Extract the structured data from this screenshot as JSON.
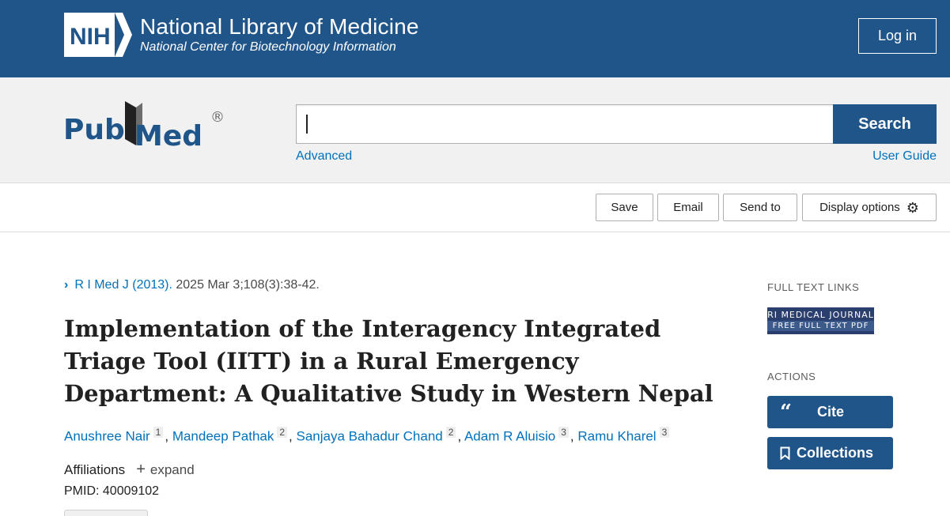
{
  "nih": {
    "title": "National Library of Medicine",
    "subtitle": "National Center for Biotechnology Information",
    "login": "Log in",
    "badge": "NIH"
  },
  "search": {
    "logo_left": "Pub",
    "logo_right": "Med",
    "registered": "®",
    "value": "",
    "button": "Search",
    "advanced": "Advanced",
    "user_guide": "User Guide"
  },
  "toolbar": {
    "save": "Save",
    "email": "Email",
    "send_to": "Send to",
    "display_options": "Display options",
    "gear_icon": "gear-icon"
  },
  "article": {
    "journal": "R I Med J (2013).",
    "citation": " 2025 Mar 3;108(3):38-42.",
    "title": "Implementation of the Interagency Integrated Triage Tool (IITT) in a Rural Emergency Department: A Qualitative Study in Western Nepal",
    "authors": [
      {
        "name": "Anushree Nair",
        "aff": "1"
      },
      {
        "name": "Mandeep Pathak",
        "aff": "2"
      },
      {
        "name": "Sanjaya Bahadur Chand",
        "aff": "2"
      },
      {
        "name": "Adam R Aluisio",
        "aff": "3"
      },
      {
        "name": "Ramu Kharel",
        "aff": "3"
      }
    ],
    "affiliations_label": "Affiliations",
    "expand_label": "expand",
    "pmid": "PMID: 40009102"
  },
  "sidebar": {
    "full_text_heading": "FULL TEXT LINKS",
    "ri_badge_top": "RI MEDICAL JOURNAL",
    "ri_badge_bottom": "FREE FULL TEXT PDF",
    "actions_heading": "ACTIONS",
    "cite": "Cite",
    "collections": "Collections"
  },
  "colors": {
    "nih_blue": "#20558a",
    "link_blue": "#0071bc",
    "band_gray": "#f1f1f1"
  }
}
